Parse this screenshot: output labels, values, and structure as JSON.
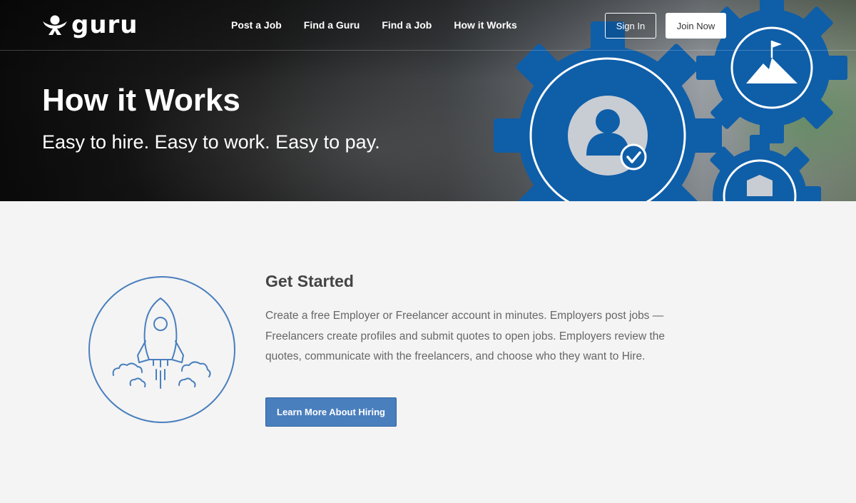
{
  "brand": {
    "name": "guru"
  },
  "nav": {
    "links": [
      "Post a Job",
      "Find a Guru",
      "Find a Job",
      "How it Works"
    ],
    "signin_label": "Sign In",
    "join_label": "Join Now"
  },
  "hero": {
    "title": "How it Works",
    "subtitle": "Easy to hire. Easy to work. Easy to pay."
  },
  "section": {
    "title": "Get Started",
    "body": "Create a free Employer or Freelancer account in minutes. Employers post jobs — Freelancers create profiles and submit quotes to open jobs. Employers review the quotes, communicate with the freelancers, and choose who they want to Hire.",
    "cta_label": "Learn More About Hiring"
  },
  "colors": {
    "accent_blue": "#4a7fbe",
    "gear_blue": "#0f5ea8"
  },
  "icons": [
    "guru-logo-icon",
    "gear-person-icon",
    "gear-mountain-icon",
    "gear-shield-icon",
    "rocket-icon"
  ]
}
